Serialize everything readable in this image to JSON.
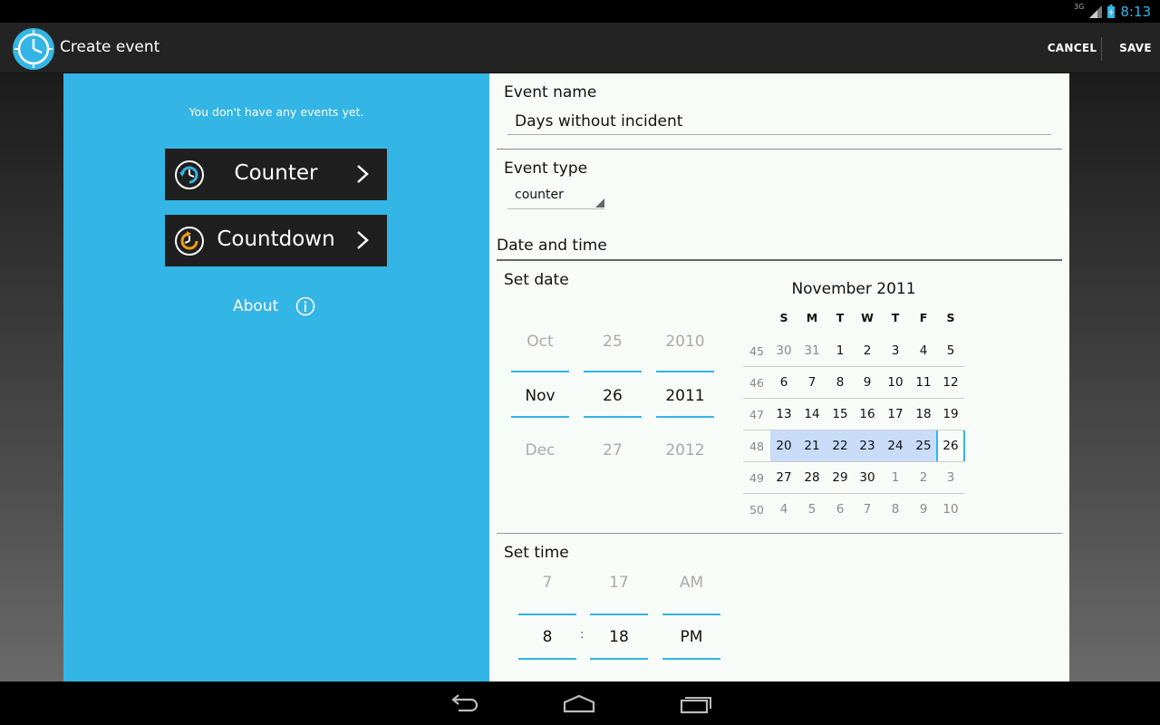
{
  "status": {
    "network": "3G",
    "time": "8:13"
  },
  "actionbar": {
    "title": "Create event",
    "cancel": "CANCEL",
    "save": "SAVE"
  },
  "left": {
    "empty_text": "You don't have any events yet.",
    "counter_label": "Counter",
    "countdown_label": "Countdown",
    "about_label": "About"
  },
  "form": {
    "event_name_label": "Event name",
    "event_name_value": "Days without incident",
    "event_type_label": "Event type",
    "event_type_value": "counter",
    "section_date_time": "Date and time",
    "set_date_label": "Set date",
    "set_time_label": "Set time",
    "date_picker": {
      "month": [
        "Oct",
        "Nov",
        "Dec"
      ],
      "day": [
        "25",
        "26",
        "27"
      ],
      "year": [
        "2010",
        "2011",
        "2012"
      ]
    },
    "time_picker": {
      "hour": [
        "7",
        "8"
      ],
      "minute": [
        "17",
        "18"
      ],
      "ampm": [
        "AM",
        "PM"
      ],
      "separator": ":"
    }
  },
  "calendar": {
    "title": "November 2011",
    "weekday_headers": [
      "S",
      "M",
      "T",
      "W",
      "T",
      "F",
      "S"
    ],
    "weeks": [
      {
        "num": "45",
        "days": [
          "30",
          "31",
          "1",
          "2",
          "3",
          "4",
          "5"
        ],
        "dim": [
          true,
          true,
          false,
          false,
          false,
          false,
          false
        ]
      },
      {
        "num": "46",
        "days": [
          "6",
          "7",
          "8",
          "9",
          "10",
          "11",
          "12"
        ],
        "dim": [
          false,
          false,
          false,
          false,
          false,
          false,
          false
        ]
      },
      {
        "num": "47",
        "days": [
          "13",
          "14",
          "15",
          "16",
          "17",
          "18",
          "19"
        ],
        "dim": [
          false,
          false,
          false,
          false,
          false,
          false,
          false
        ]
      },
      {
        "num": "48",
        "days": [
          "20",
          "21",
          "22",
          "23",
          "24",
          "25",
          "26"
        ],
        "dim": [
          false,
          false,
          false,
          false,
          false,
          false,
          false
        ]
      },
      {
        "num": "49",
        "days": [
          "27",
          "28",
          "29",
          "30",
          "1",
          "2",
          "3"
        ],
        "dim": [
          false,
          false,
          false,
          false,
          true,
          true,
          true
        ]
      },
      {
        "num": "50",
        "days": [
          "4",
          "5",
          "6",
          "7",
          "8",
          "9",
          "10"
        ],
        "dim": [
          true,
          true,
          true,
          true,
          true,
          true,
          true
        ]
      }
    ],
    "selected_day": "26"
  },
  "colors": {
    "accent": "#33b5e5",
    "orange": "#f39c12",
    "selection": "#c8dcf8"
  }
}
